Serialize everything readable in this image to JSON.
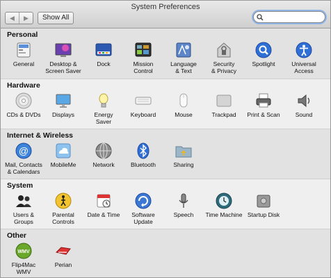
{
  "window": {
    "title": "System Preferences",
    "show_all": "Show All",
    "search_value": "",
    "search_placeholder": ""
  },
  "sections": [
    {
      "title": "Personal",
      "items": [
        {
          "label": "General",
          "icon": "general-icon"
        },
        {
          "label": "Desktop &\nScreen Saver",
          "icon": "desktop-icon"
        },
        {
          "label": "Dock",
          "icon": "dock-icon"
        },
        {
          "label": "Mission\nControl",
          "icon": "mission-control-icon"
        },
        {
          "label": "Language\n& Text",
          "icon": "language-icon"
        },
        {
          "label": "Security\n& Privacy",
          "icon": "security-icon"
        },
        {
          "label": "Spotlight",
          "icon": "spotlight-icon"
        },
        {
          "label": "Universal\nAccess",
          "icon": "universal-access-icon"
        }
      ]
    },
    {
      "title": "Hardware",
      "items": [
        {
          "label": "CDs & DVDs",
          "icon": "cd-icon"
        },
        {
          "label": "Displays",
          "icon": "displays-icon"
        },
        {
          "label": "Energy\nSaver",
          "icon": "energy-saver-icon"
        },
        {
          "label": "Keyboard",
          "icon": "keyboard-icon"
        },
        {
          "label": "Mouse",
          "icon": "mouse-icon"
        },
        {
          "label": "Trackpad",
          "icon": "trackpad-icon"
        },
        {
          "label": "Print & Scan",
          "icon": "printer-icon"
        },
        {
          "label": "Sound",
          "icon": "speaker-icon"
        }
      ]
    },
    {
      "title": "Internet & Wireless",
      "items": [
        {
          "label": "Mail, Contacts\n& Calendars",
          "icon": "mail-icon"
        },
        {
          "label": "MobileMe",
          "icon": "mobileme-icon"
        },
        {
          "label": "Network",
          "icon": "network-icon"
        },
        {
          "label": "Bluetooth",
          "icon": "bluetooth-icon"
        },
        {
          "label": "Sharing",
          "icon": "sharing-icon"
        }
      ]
    },
    {
      "title": "System",
      "items": [
        {
          "label": "Users &\nGroups",
          "icon": "users-icon"
        },
        {
          "label": "Parental\nControls",
          "icon": "parental-controls-icon"
        },
        {
          "label": "Date & Time",
          "icon": "date-time-icon"
        },
        {
          "label": "Software\nUpdate",
          "icon": "software-update-icon"
        },
        {
          "label": "Speech",
          "icon": "microphone-icon"
        },
        {
          "label": "Time Machine",
          "icon": "time-machine-icon"
        },
        {
          "label": "Startup Disk",
          "icon": "startup-disk-icon"
        }
      ]
    },
    {
      "title": "Other",
      "items": [
        {
          "label": "Flip4Mac\nWMV",
          "icon": "flip4mac-icon"
        },
        {
          "label": "Perian",
          "icon": "perian-icon"
        }
      ]
    }
  ],
  "colors": {
    "accent_blue": "#2f6fd6",
    "search_focus": "#8fb4e6",
    "toolbar_top": "#e9e9e9",
    "toolbar_bottom": "#cfcfcf"
  }
}
